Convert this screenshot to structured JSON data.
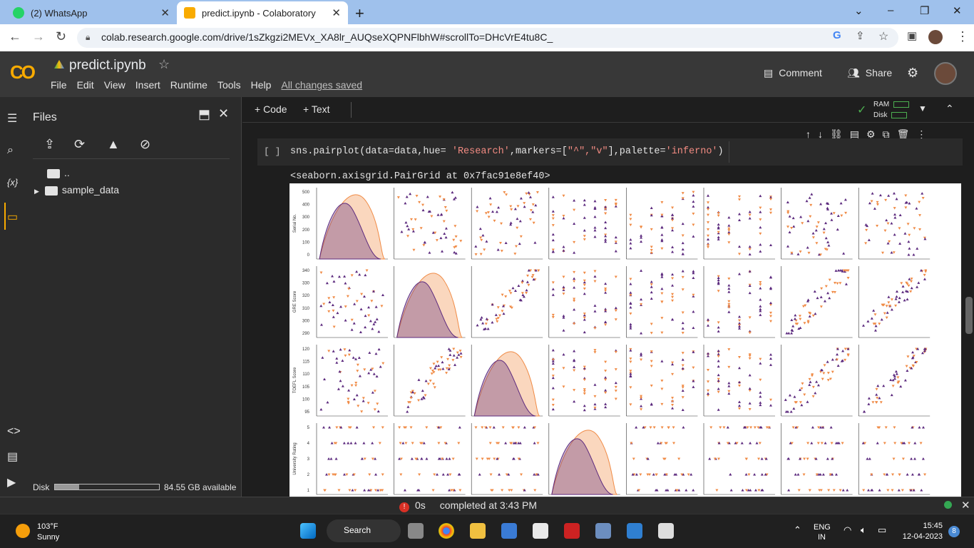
{
  "browser": {
    "tabs": [
      {
        "title": "(2) WhatsApp",
        "favicon": "whatsapp-icon"
      },
      {
        "title": "predict.ipynb - Colaboratory",
        "favicon": "colab-icon"
      }
    ],
    "url": "colab.research.google.com/drive/1sZkgzi2MEVx_XA8lr_AUQseXQPNFlbhW#scrollTo=DHcVrE4tu8C_"
  },
  "colab": {
    "logo": "CO",
    "notebook_title": "predict.ipynb",
    "menu": [
      "File",
      "Edit",
      "View",
      "Insert",
      "Runtime",
      "Tools",
      "Help"
    ],
    "saved_status": "All changes saved",
    "comment_label": "Comment",
    "share_label": "Share",
    "add_code": "+ Code",
    "add_text": "+ Text",
    "ram_label": "RAM",
    "disk_label": "Disk"
  },
  "sidebar": {
    "title": "Files",
    "tree": [
      {
        "name": ".."
      },
      {
        "name": "sample_data"
      }
    ],
    "disk_label": "Disk",
    "disk_available": "84.55 GB available",
    "disk_usage_fraction": 0.23
  },
  "cell": {
    "run_indicator": "[ ]",
    "code_pre": "sns.pairplot(data=data,hue= ",
    "code_str1": "'Research'",
    "code_mid": ",markers=[",
    "code_str2": "\"^\",\"v\"",
    "code_mid2": "],palette=",
    "code_str3": "'inferno'",
    "code_post": ")",
    "output": "<seaborn.axisgrid.PairGrid at 0x7fac91e8ef40>"
  },
  "chart_data": {
    "type": "scatter",
    "kind": "pairplot",
    "hue": "Research",
    "palette": {
      "0": "#5c2a7e",
      "1": "#f08b46"
    },
    "markers": [
      "^",
      "v"
    ],
    "row_labels": [
      "Serial No.",
      "GRE Score",
      "TOEFL Score",
      "University Rating"
    ],
    "row_ticks": [
      [
        "0",
        "100",
        "200",
        "300",
        "400",
        "500"
      ],
      [
        "290",
        "300",
        "310",
        "320",
        "330",
        "340"
      ],
      [
        "95",
        "100",
        "105",
        "110",
        "115",
        "120"
      ],
      [
        "1",
        "2",
        "3",
        "4",
        "5"
      ]
    ],
    "num_columns": 8
  },
  "status": {
    "duration": "0s",
    "message": "completed at 3:43 PM"
  },
  "taskbar": {
    "temperature": "103°F",
    "weather": "Sunny",
    "search": "Search",
    "lang": "ENG",
    "region": "IN",
    "time": "15:45",
    "date": "12-04-2023",
    "notifications": "8"
  }
}
